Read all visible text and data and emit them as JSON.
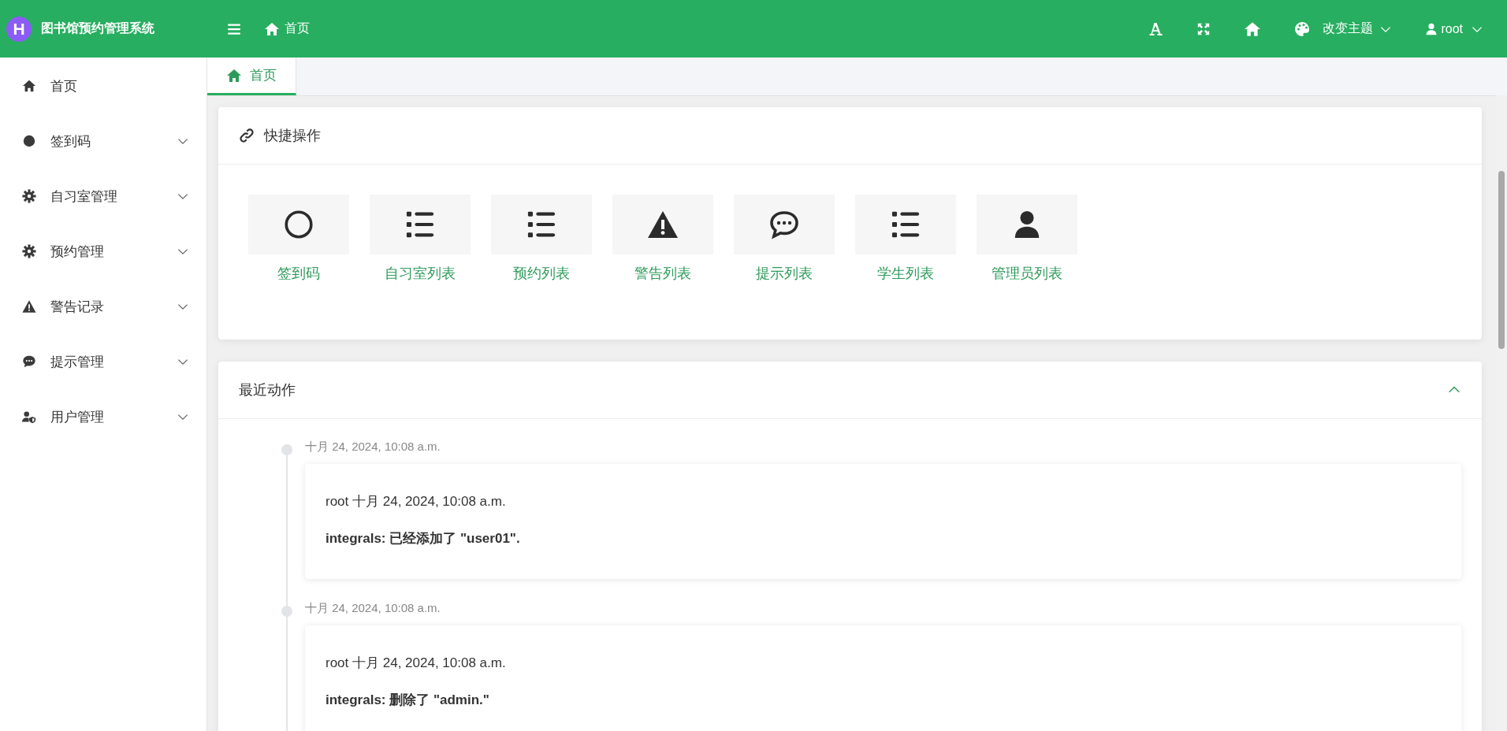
{
  "header": {
    "logo_letter": "H",
    "title": "图书馆预约管理系统",
    "breadcrumb": "首页",
    "theme_label": "改变主题",
    "user": "root"
  },
  "sidebar": {
    "items": [
      {
        "label": "首页",
        "kind": "home",
        "expandable": false
      },
      {
        "label": "签到码",
        "kind": "dot",
        "expandable": true
      },
      {
        "label": "自习室管理",
        "kind": "gear",
        "expandable": true
      },
      {
        "label": "预约管理",
        "kind": "gear",
        "expandable": true
      },
      {
        "label": "警告记录",
        "kind": "warning",
        "expandable": true
      },
      {
        "label": "提示管理",
        "kind": "chat",
        "expandable": true
      },
      {
        "label": "用户管理",
        "kind": "userplus",
        "expandable": true
      }
    ]
  },
  "tabs": [
    {
      "label": "首页",
      "selected": true
    }
  ],
  "quick_actions": {
    "title": "快捷操作",
    "items": [
      {
        "label": "签到码",
        "kind": "circle"
      },
      {
        "label": "自习室列表",
        "kind": "list"
      },
      {
        "label": "预约列表",
        "kind": "list"
      },
      {
        "label": "警告列表",
        "kind": "warning"
      },
      {
        "label": "提示列表",
        "kind": "chat"
      },
      {
        "label": "学生列表",
        "kind": "list"
      },
      {
        "label": "管理员列表",
        "kind": "user"
      }
    ]
  },
  "recent_actions": {
    "title": "最近动作",
    "expanded": true,
    "entries": [
      {
        "time": "十月 24, 2024, 10:08 a.m.",
        "author_line": "root 十月 24, 2024, 10:08 a.m.",
        "message": "integrals: 已经添加了 \"user01\"."
      },
      {
        "time": "十月 24, 2024, 10:08 a.m.",
        "author_line": "root 十月 24, 2024, 10:08 a.m.",
        "message": "integrals: 删除了 \"admin.\""
      }
    ]
  }
}
